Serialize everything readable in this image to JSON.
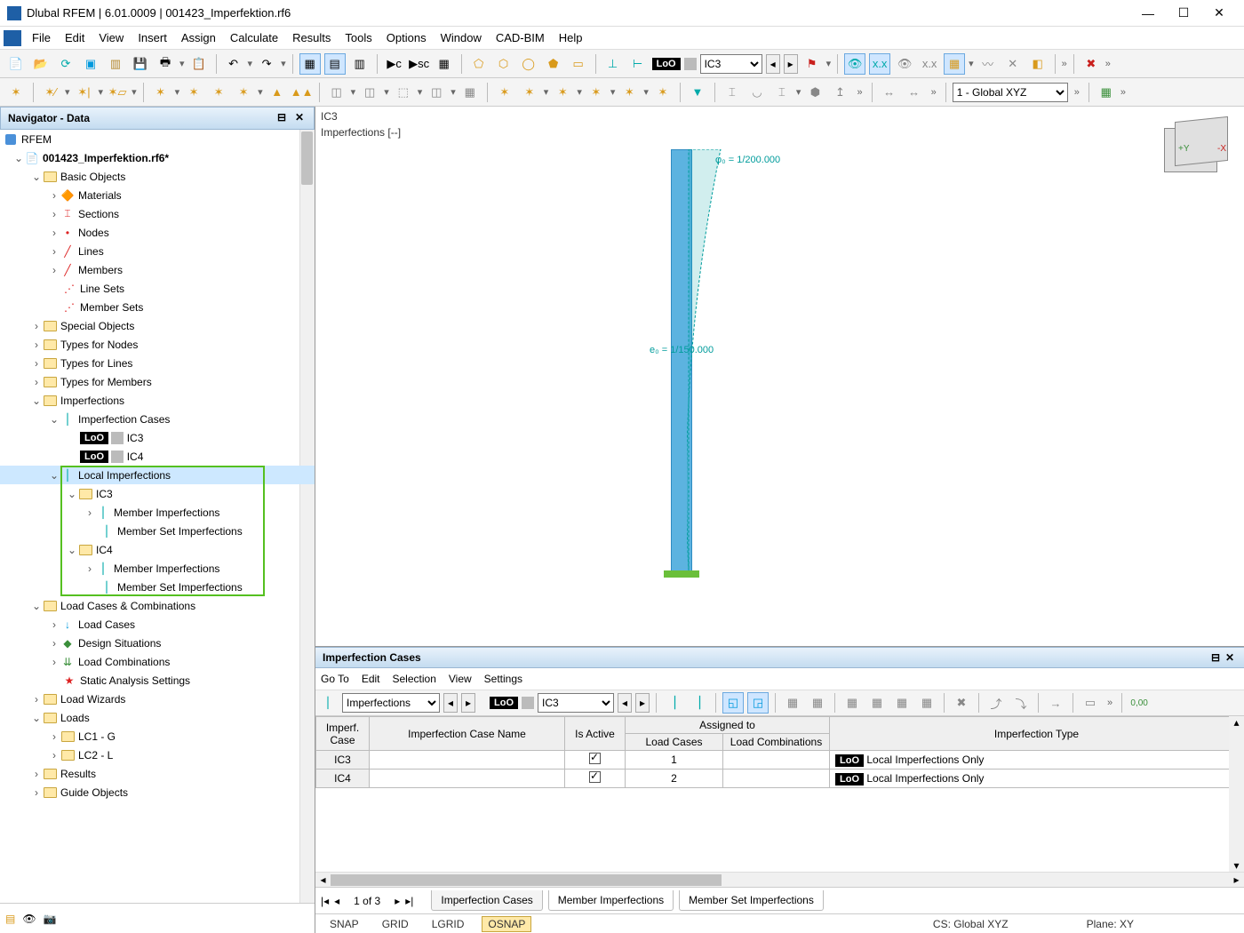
{
  "title": "Dlubal RFEM | 6.01.0009 | 001423_Imperfektion.rf6",
  "menu": [
    "File",
    "Edit",
    "View",
    "Insert",
    "Assign",
    "Calculate",
    "Results",
    "Tools",
    "Options",
    "Window",
    "CAD-BIM",
    "Help"
  ],
  "toolbar_selects": {
    "loo": "LoO",
    "ic": "IC3",
    "coord": "1 - Global XYZ"
  },
  "navigator": {
    "title": "Navigator - Data",
    "root": "RFEM",
    "file": "001423_Imperfektion.rf6*",
    "basic_objects": "Basic Objects",
    "children_basic": [
      "Materials",
      "Sections",
      "Nodes",
      "Lines",
      "Members",
      "Line Sets",
      "Member Sets"
    ],
    "mid_folders": [
      "Special Objects",
      "Types for Nodes",
      "Types for Lines",
      "Types for Members"
    ],
    "imperfections": "Imperfections",
    "imp_cases": "Imperfection Cases",
    "ic_list": [
      "IC3",
      "IC4"
    ],
    "local_imp": "Local Imperfections",
    "li_children": {
      "ic3": "IC3",
      "ic4": "IC4",
      "mi": "Member Imperfections",
      "msi": "Member Set Imperfections"
    },
    "lcc": "Load Cases & Combinations",
    "lcc_children": [
      "Load Cases",
      "Design Situations",
      "Load Combinations",
      "Static Analysis Settings"
    ],
    "bottom_folders": [
      "Load Wizards",
      "Loads"
    ],
    "loads_children": [
      "LC1 - G",
      "LC2 - L"
    ],
    "tail_folders": [
      "Results",
      "Guide Objects"
    ]
  },
  "viewport": {
    "l1": "IC3",
    "l2": "Imperfections [--]",
    "annot_top": "φ₀ =  1/200.000",
    "annot_mid": "e₀ =  1/150.000"
  },
  "lower": {
    "title": "Imperfection Cases",
    "menu": [
      "Go To",
      "Edit",
      "Selection",
      "View",
      "Settings"
    ],
    "sel_label": "Imperfections",
    "sel_loo": "LoO",
    "sel_ic": "IC3",
    "columns": {
      "c1a": "Imperf.",
      "c1b": "Case",
      "c2": "Imperfection Case Name",
      "c3": "Is Active",
      "grp": "Assigned to",
      "c4": "Load Cases",
      "c5": "Load Combinations",
      "c6": "Imperfection Type"
    },
    "rows": [
      {
        "id": "IC3",
        "name": "",
        "active": true,
        "lc": "1",
        "lco": "",
        "type": "Local Imperfections Only"
      },
      {
        "id": "IC4",
        "name": "",
        "active": true,
        "lc": "2",
        "lco": "",
        "type": "Local Imperfections Only"
      }
    ],
    "pager": "1 of 3",
    "tabs": [
      "Imperfection Cases",
      "Member Imperfections",
      "Member Set Imperfections"
    ]
  },
  "status": {
    "snap": "SNAP",
    "grid": "GRID",
    "lgrid": "LGRID",
    "osnap": "OSNAP",
    "cs": "CS: Global XYZ",
    "plane": "Plane: XY"
  }
}
